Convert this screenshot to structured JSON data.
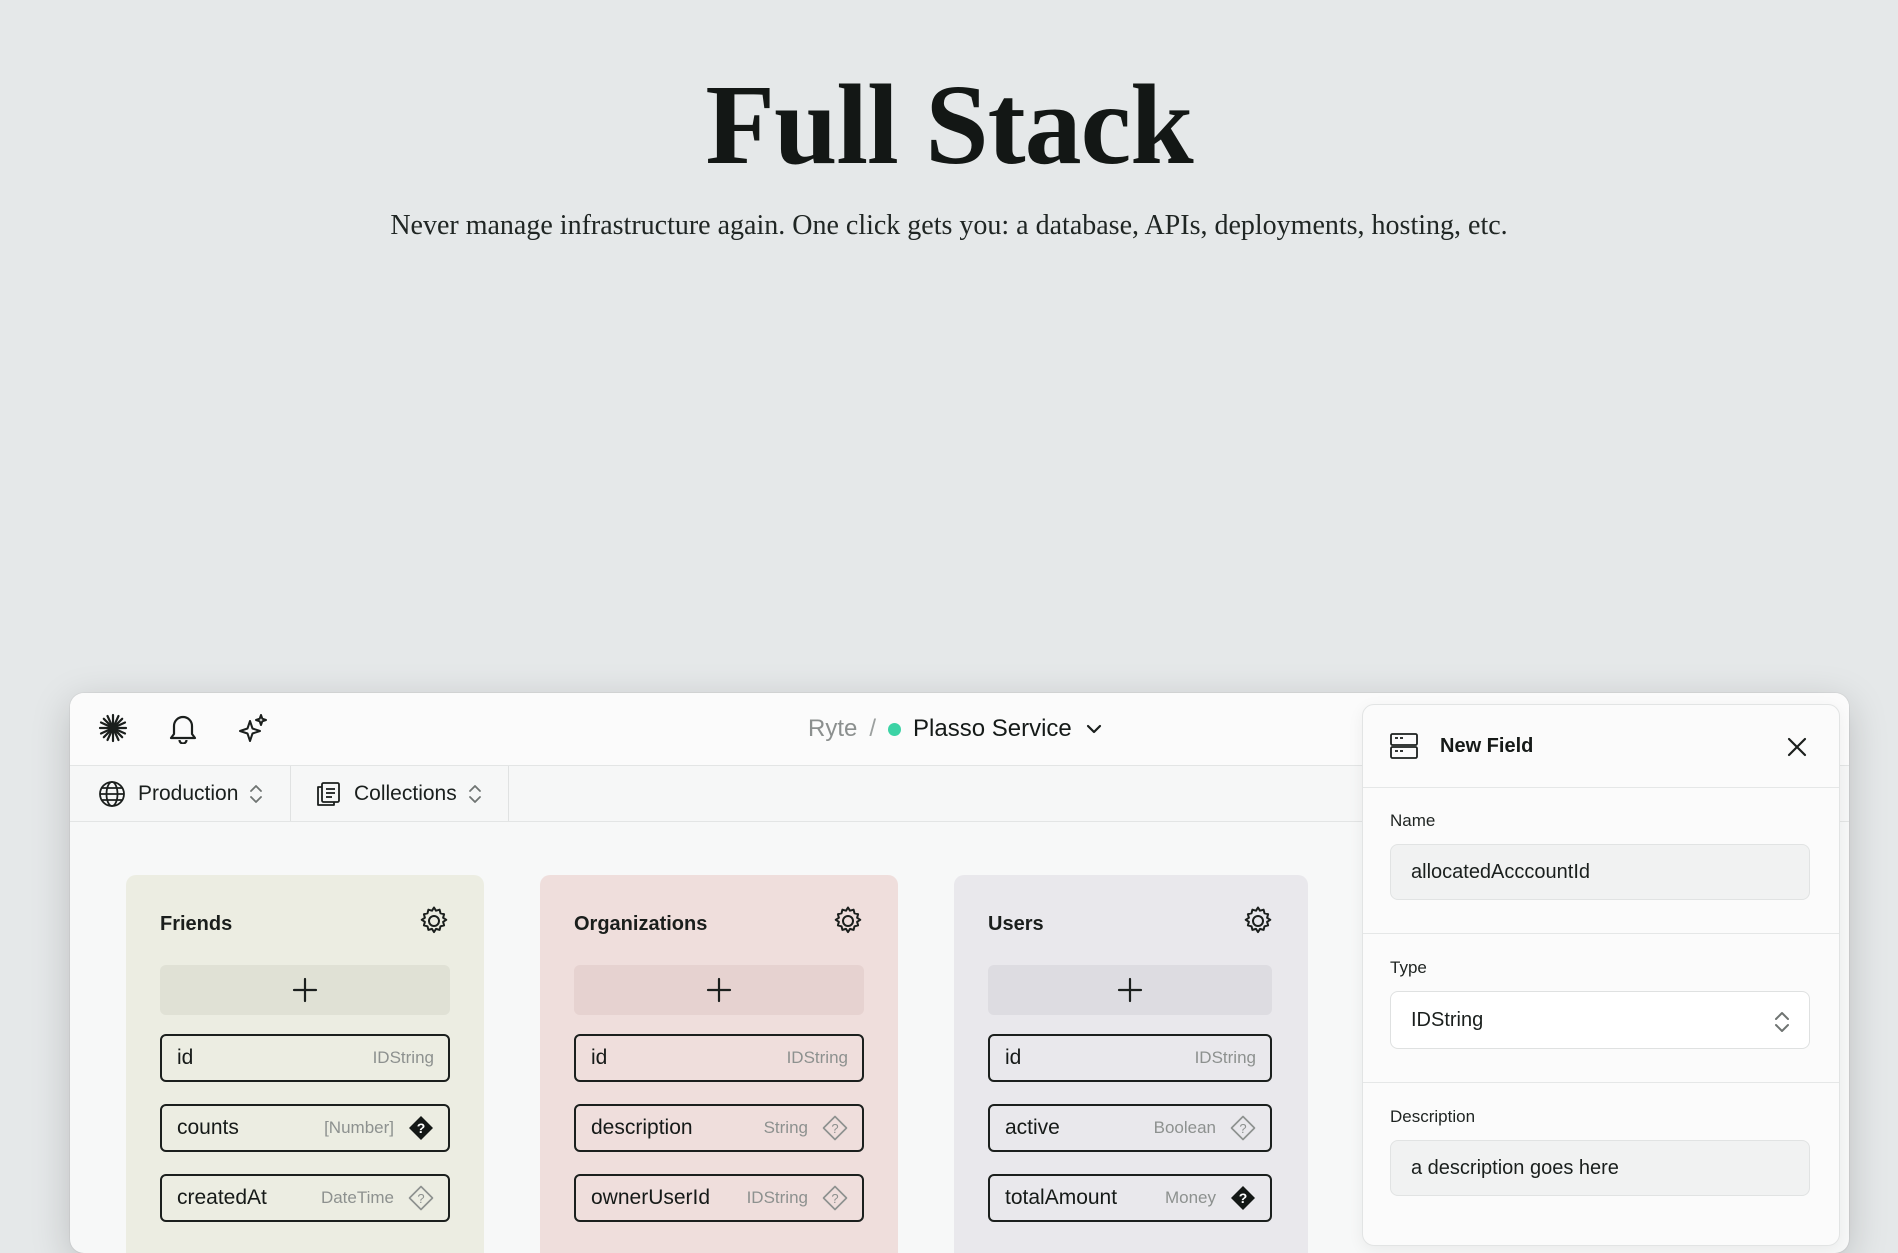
{
  "hero": {
    "title": "Full Stack",
    "subtitle": "Never manage infrastructure again. One click gets you: a database, APIs, deployments, hosting, etc."
  },
  "topbar": {
    "icons": [
      "asterisk-icon",
      "bell-icon",
      "sparkles-icon"
    ],
    "breadcrumb_org": "Ryte",
    "breadcrumb_sep": "/",
    "project_name": "Plasso Service",
    "status_color": "#3cd3a5"
  },
  "subbar": {
    "environment": "Production",
    "section": "Collections"
  },
  "collections": [
    {
      "title": "Friends",
      "bg": "#ecede2",
      "button_bg": "#e0e1d5",
      "fields": [
        {
          "name": "id",
          "type": "IDString",
          "icon": "none"
        },
        {
          "name": "counts",
          "type": "[Number]",
          "icon": "required"
        },
        {
          "name": "createdAt",
          "type": "DateTime",
          "icon": "optional"
        }
      ]
    },
    {
      "title": "Organizations",
      "bg": "#efdedc",
      "button_bg": "#e6d2d0",
      "fields": [
        {
          "name": "id",
          "type": "IDString",
          "icon": "none"
        },
        {
          "name": "description",
          "type": "String",
          "icon": "optional"
        },
        {
          "name": "ownerUserId",
          "type": "IDString",
          "icon": "optional"
        }
      ]
    },
    {
      "title": "Users",
      "bg": "#e9e8ec",
      "button_bg": "#dddce1",
      "fields": [
        {
          "name": "id",
          "type": "IDString",
          "icon": "none"
        },
        {
          "name": "active",
          "type": "Boolean",
          "icon": "optional"
        },
        {
          "name": "totalAmount",
          "type": "Money",
          "icon": "required"
        }
      ]
    }
  ],
  "panel": {
    "title": "New Field",
    "name_label": "Name",
    "name_value": "allocatedAcccountId",
    "type_label": "Type",
    "type_value": "IDString",
    "description_label": "Description",
    "description_value": "a description goes here"
  }
}
